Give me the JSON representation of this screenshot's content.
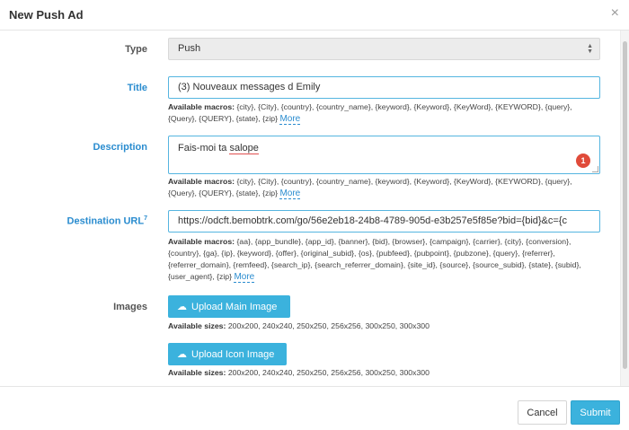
{
  "modal": {
    "title": "New Push Ad",
    "close": "×"
  },
  "type": {
    "label": "Type",
    "value": "Push"
  },
  "title_field": {
    "label": "Title",
    "value": "(3) Nouveaux messages d Emily",
    "macros_label": "Available macros:",
    "macros": "{city}, {City}, {country}, {country_name}, {keyword}, {Keyword}, {KeyWord}, {KEYWORD}, {query}, {Query}, {QUERY}, {state}, {zip}",
    "more": "More"
  },
  "description": {
    "label": "Description",
    "value_prefix": "Fais-moi ta ",
    "value_misspelled": "salope",
    "badge": "1",
    "macros_label": "Available macros:",
    "macros": "{city}, {City}, {country}, {country_name}, {keyword}, {Keyword}, {KeyWord}, {KEYWORD}, {query}, {Query}, {QUERY}, {state}, {zip}",
    "more": "More"
  },
  "destination": {
    "label": "Destination URL",
    "superscript": "7",
    "value": "https://odcft.bemobtrk.com/go/56e2eb18-24b8-4789-905d-e3b257e5f85e?bid={bid}&c={c",
    "macros_label": "Available macros:",
    "macros": "{aa}, {app_bundle}, {app_id}, {banner}, {bid}, {browser}, {campaign}, {carrier}, {city}, {conversion}, {country}, {ga}, {ip}, {keyword}, {offer}, {original_subid}, {os}, {pubfeed}, {pubpoint}, {pubzone}, {query}, {referrer}, {referrer_domain}, {remfeed}, {search_ip}, {search_referrer_domain}, {site_id}, {source}, {source_subid}, {state}, {subid}, {user_agent}, {zip}",
    "more": "More"
  },
  "images": {
    "label": "Images",
    "main_button": "Upload Main Image",
    "icon_button": "Upload Icon Image",
    "sizes_label": "Available sizes:",
    "main_sizes": "200x200, 240x240, 250x250, 256x256, 300x250, 300x300",
    "icon_sizes": "200x200, 240x240, 250x250, 256x256, 300x250, 300x300",
    "upload_icon": "cloud-upload-icon"
  },
  "footer": {
    "cancel": "Cancel",
    "submit": "Submit"
  },
  "colors": {
    "accent": "#3bb2dd",
    "label_blue": "#2a8ccf",
    "badge_red": "#e04b3a"
  }
}
